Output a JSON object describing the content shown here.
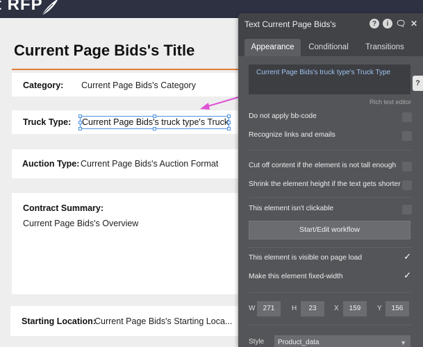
{
  "app": {
    "logo_text": "t RFP"
  },
  "page": {
    "title": "Current Page Bids's Title",
    "fields": [
      {
        "label": "Category:",
        "value": "Current Page Bids's Category"
      },
      {
        "label": "Truck Type:",
        "value": "Current Page Bids's truck type's Truck..."
      },
      {
        "label": "Auction Type:",
        "value": "Current Page Bids's Auction Format"
      },
      {
        "label": "Contract Summary:",
        "value": "Current Page Bids's Overview"
      },
      {
        "label": "Starting Location:",
        "value": "Current Page Bids's Starting Loca..."
      }
    ]
  },
  "panel": {
    "title": "Text Current Page Bids's",
    "tabs": [
      "Appearance",
      "Conditional",
      "Transitions"
    ],
    "active_tab": "Appearance",
    "rich_text_value": "Current Page Bids's truck type's Truck Type",
    "rich_text_caption": "Rich text editor",
    "side_tab": "?",
    "options": [
      {
        "label": "Do not apply bb-code",
        "checked": false
      },
      {
        "label": "Recognize links and emails",
        "checked": false
      },
      {
        "label": "Cut off content if the element is not tall enough",
        "checked": false
      },
      {
        "label": "Shrink the element height if the text gets shorter",
        "checked": false
      },
      {
        "label": "This element isn't clickable",
        "checked": false
      },
      {
        "label": "This element is visible on page load",
        "checked": true
      },
      {
        "label": "Make this element fixed-width",
        "checked": true
      }
    ],
    "workflow_button": "Start/Edit workflow",
    "dimensions": {
      "w_label": "W",
      "w": "271",
      "h_label": "H",
      "h": "23",
      "x_label": "X",
      "x": "159",
      "y_label": "Y",
      "y": "156"
    },
    "style_label": "Style",
    "style_value": "Product_data",
    "icons": [
      "help-icon",
      "info-icon",
      "comment-icon",
      "close-icon"
    ]
  },
  "colors": {
    "accent_rule": "#e07b39",
    "selection": "#4a90e2",
    "arrow": "#e052d6",
    "panel_bg": "#545558"
  }
}
